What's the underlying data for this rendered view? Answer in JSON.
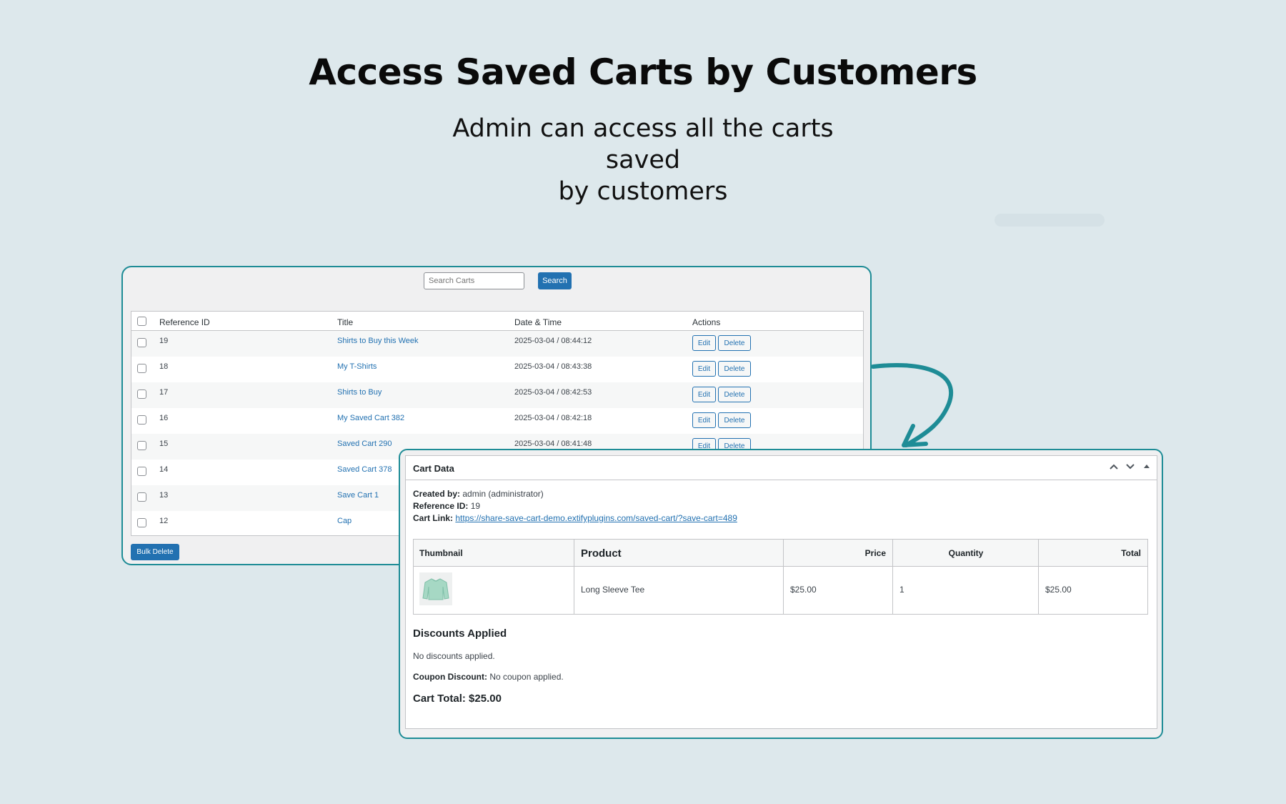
{
  "hero": {
    "title": "Access Saved Carts by Customers",
    "subtitle_line1": "Admin can access all the carts saved",
    "subtitle_line2": "by customers"
  },
  "carts_list": {
    "search": {
      "placeholder": "Search Carts",
      "button_label": "Search"
    },
    "columns": [
      "Reference ID",
      "Title",
      "Date & Time",
      "Actions"
    ],
    "rows": [
      {
        "ref": "19",
        "title": "Shirts to Buy this Week",
        "datetime": "2025-03-04 / 08:44:12"
      },
      {
        "ref": "18",
        "title": "My T-Shirts",
        "datetime": "2025-03-04 / 08:43:38"
      },
      {
        "ref": "17",
        "title": "Shirts to Buy",
        "datetime": "2025-03-04 / 08:42:53"
      },
      {
        "ref": "16",
        "title": "My Saved Cart 382",
        "datetime": "2025-03-04 / 08:42:18"
      },
      {
        "ref": "15",
        "title": "Saved Cart 290",
        "datetime": "2025-03-04 / 08:41:48"
      },
      {
        "ref": "14",
        "title": "Saved Cart 378",
        "datetime": ""
      },
      {
        "ref": "13",
        "title": "Save Cart 1",
        "datetime": ""
      },
      {
        "ref": "12",
        "title": "Cap",
        "datetime": ""
      }
    ],
    "edit_label": "Edit",
    "delete_label": "Delete",
    "bulk_delete_label": "Bulk Delete"
  },
  "cart_data": {
    "box_title": "Cart Data",
    "created_by_label": "Created by:",
    "created_by_value": "admin (administrator)",
    "reference_label": "Reference ID:",
    "reference_value": "19",
    "link_label": "Cart Link:",
    "link_value": "https://share-save-cart-demo.extifyplugins.com/saved-cart/?save-cart=489",
    "columns": [
      "Thumbnail",
      "Product",
      "Price",
      "Quantity",
      "Total"
    ],
    "item": {
      "product": "Long Sleeve Tee",
      "price": "$25.00",
      "quantity": "1",
      "total": "$25.00"
    },
    "discounts_heading": "Discounts Applied",
    "discounts_text": "No discounts applied.",
    "coupon_label": "Coupon Discount:",
    "coupon_value": "No coupon applied.",
    "cart_total": "Cart Total: $25.00"
  },
  "colors": {
    "accent": "#2271b1",
    "panel_border": "#1e8c96",
    "background": "#dde8ec"
  }
}
